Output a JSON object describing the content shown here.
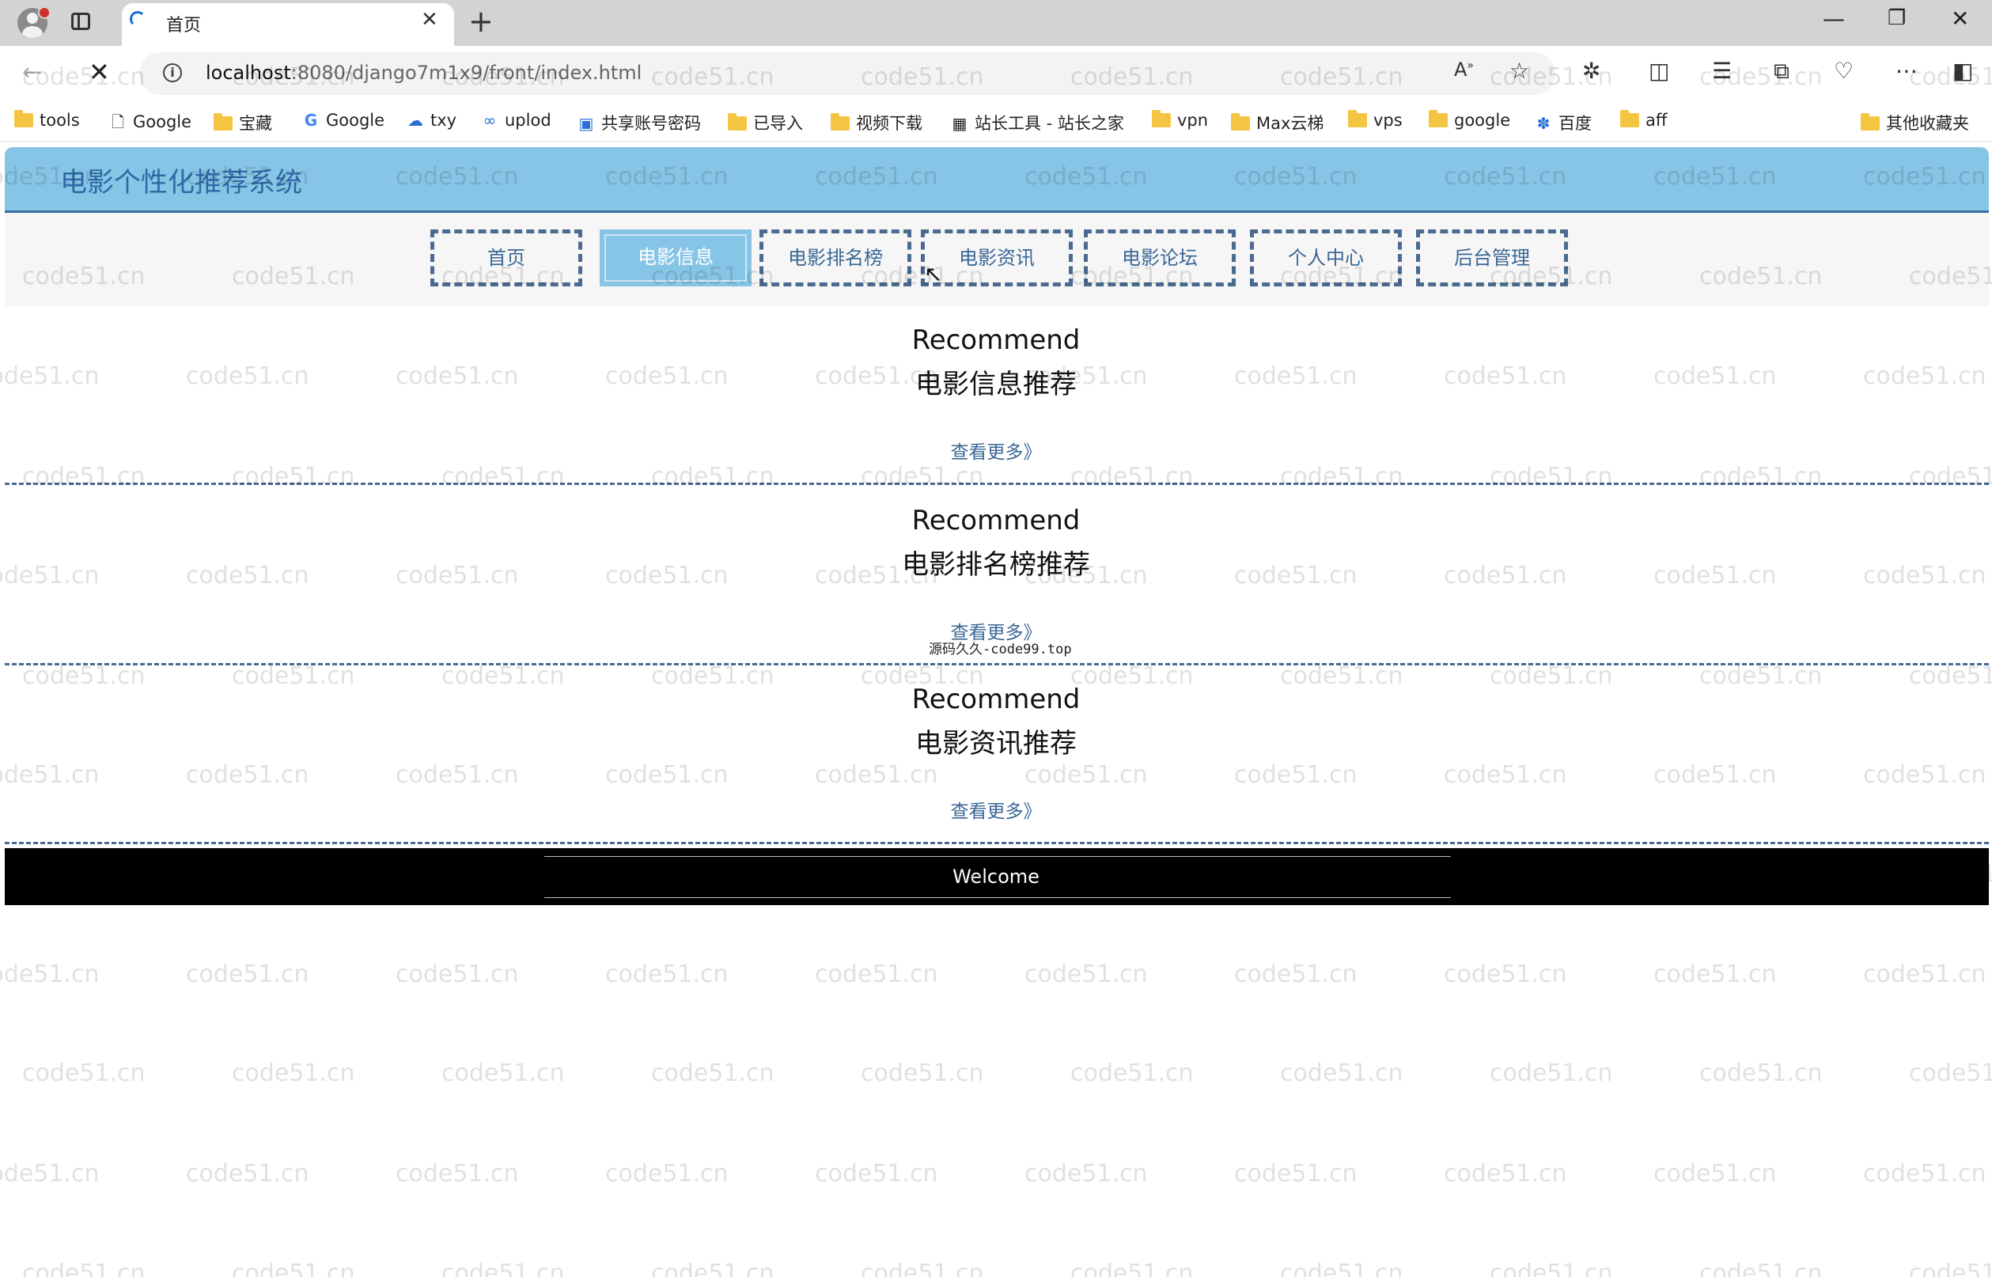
{
  "browser": {
    "tab_title": "首页",
    "url_host": "localhost",
    "url_rest": ":8080/django7m1x9/front/index.html",
    "bookmarks": [
      {
        "label": "tools",
        "icon": "folder-icon"
      },
      {
        "label": "Google",
        "icon": "page-icon"
      },
      {
        "label": "宝藏",
        "icon": "folder-icon"
      },
      {
        "label": "Google",
        "icon": "google-icon"
      },
      {
        "label": "txy",
        "icon": "cloud-icon"
      },
      {
        "label": "uplod",
        "icon": "link-icon"
      },
      {
        "label": "共享账号密码",
        "icon": "app-icon"
      },
      {
        "label": "已导入",
        "icon": "folder-icon"
      },
      {
        "label": "视频下载",
        "icon": "folder-icon"
      },
      {
        "label": "站长工具 - 站长之家",
        "icon": "site-icon"
      },
      {
        "label": "vpn",
        "icon": "folder-icon"
      },
      {
        "label": "Max云梯",
        "icon": "folder-icon"
      },
      {
        "label": "vps",
        "icon": "folder-icon"
      },
      {
        "label": "google",
        "icon": "folder-icon"
      },
      {
        "label": "百度",
        "icon": "baidu-icon"
      },
      {
        "label": "aff",
        "icon": "folder-icon"
      }
    ],
    "other_bookmarks": "其他收藏夹"
  },
  "site": {
    "title": "电影个性化推荐系统",
    "nav": [
      {
        "label": "首页",
        "active": false
      },
      {
        "label": "电影信息",
        "active": true
      },
      {
        "label": "电影排名榜",
        "active": false
      },
      {
        "label": "电影资讯",
        "active": false
      },
      {
        "label": "电影论坛",
        "active": false
      },
      {
        "label": "个人中心",
        "active": false
      },
      {
        "label": "后台管理",
        "active": false
      }
    ],
    "sections": [
      {
        "en": "Recommend",
        "cn": "电影信息推荐",
        "more": "查看更多》"
      },
      {
        "en": "Recommend",
        "cn": "电影排名榜推荐",
        "more": "查看更多》"
      },
      {
        "en": "Recommend",
        "cn": "电影资讯推荐",
        "more": "查看更多》"
      }
    ],
    "note": "源码久久-code99.top",
    "footer": "Welcome"
  },
  "watermark": "code51.cn",
  "colors": {
    "header": "#87c5e6",
    "nav_text": "#3a6795",
    "site_title": "#2d6aa6"
  }
}
